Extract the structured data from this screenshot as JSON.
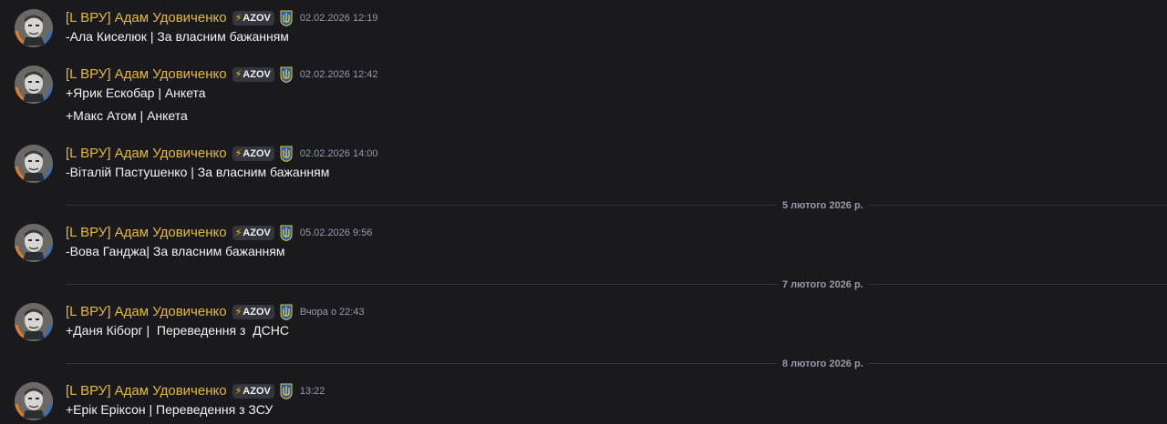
{
  "author": {
    "name": "[L ВРУ] Адам Удовиченко",
    "tag_label": "AZOV",
    "tag_icon": "lightning-bolt-icon",
    "flair_icon": "ukraine-trident-icon",
    "name_color": "#e3b93c"
  },
  "messages": [
    {
      "timestamp": "02.02.2026 12:19",
      "lines": [
        "-Ала Киселюк | За власним бажанням"
      ]
    },
    {
      "timestamp": "02.02.2026 12:42",
      "lines": [
        "+Ярик Ескобар | Анкета",
        "+Макс Атом | Анкета"
      ]
    },
    {
      "timestamp": "02.02.2026 14:00",
      "lines": [
        "-Віталій Пастушенко | За власним бажанням"
      ]
    },
    {
      "timestamp": "05.02.2026 9:56",
      "lines": [
        "-Вова Ганджа| За власним бажанням"
      ]
    },
    {
      "timestamp": "Вчора о 22:43",
      "lines": [
        "+Даня Кіборг |  Переведення з  ДСНС"
      ]
    },
    {
      "timestamp": "13:22",
      "lines": [
        "+Ерік Еріксон | Переведення з ЗСУ"
      ]
    }
  ],
  "dividers": [
    {
      "label": "5 лютого 2026 р."
    },
    {
      "label": "7 лютого 2026 р."
    },
    {
      "label": "8 лютого 2026 р."
    }
  ],
  "colors": {
    "background": "#1a1a1e",
    "message_text": "#f2f3f5",
    "timestamp": "#949ba4",
    "tag_bg": "#35363c",
    "divider_line": "#33353b"
  }
}
